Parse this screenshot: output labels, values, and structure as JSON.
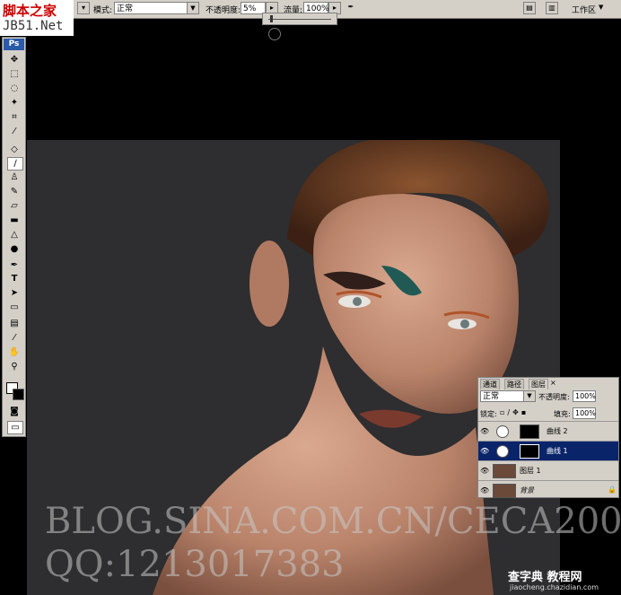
{
  "watermark_logo": {
    "line1": "脚本之家",
    "line2": "JB51.Net"
  },
  "options_bar": {
    "mode_label": "模式:",
    "mode_value": "正常",
    "opacity_label": "不透明度:",
    "opacity_value": "5%",
    "flow_label": "流量:",
    "flow_value": "100%",
    "workspace_label": "工作区"
  },
  "toolbox": {
    "ps_label": "Ps"
  },
  "layers_panel": {
    "tabs": [
      "通道",
      "路径",
      "图层"
    ],
    "blend_mode": "正常",
    "opacity_label": "不透明度:",
    "opacity_value": "100%",
    "lock_label": "锁定:",
    "fill_label": "填充:",
    "fill_value": "100%",
    "layers": [
      {
        "name": "曲线 2",
        "type": "adjustment",
        "selected": false
      },
      {
        "name": "曲线 1",
        "type": "adjustment",
        "selected": true
      },
      {
        "name": "图层 1",
        "type": "pixel",
        "selected": false
      },
      {
        "name": "背景",
        "type": "background",
        "selected": false
      }
    ]
  },
  "watermark_text": {
    "line1": "BLOG.SINA.COM.CN/CECA200",
    "line2": "QQ:1213017383"
  },
  "site_watermark": {
    "line1": "查字典 教程网",
    "line2": "jiaocheng.chazidian.com"
  },
  "colors": {
    "selected_layer": "#0a246a",
    "panel": "#d4d0c8",
    "canvas_bg": "#000000"
  }
}
